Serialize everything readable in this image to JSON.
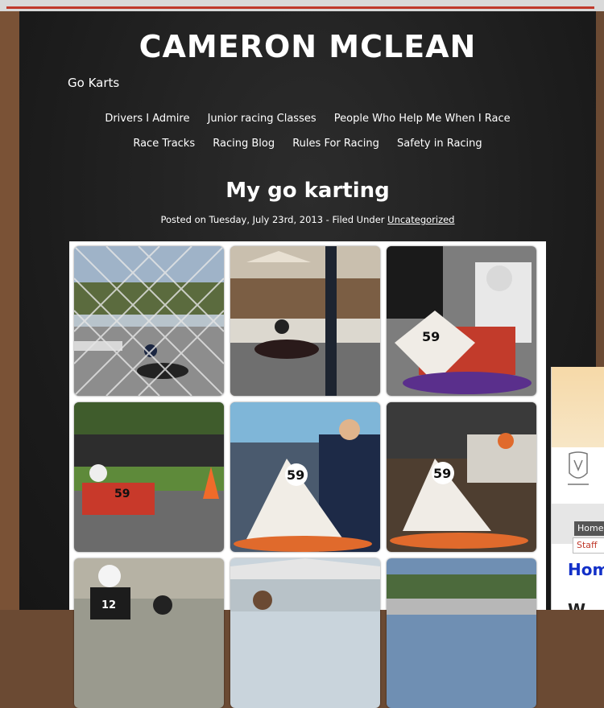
{
  "site": {
    "title": "CAMERON MCLEAN",
    "tagline": "Go Karts"
  },
  "nav": {
    "row1": [
      "Drivers I Admire",
      "Junior racing Classes",
      "People Who Help Me When I Race"
    ],
    "row2": [
      "Race Tracks",
      "Racing Blog",
      "Rules For Racing",
      "Safety in Racing"
    ]
  },
  "post": {
    "title": "My go karting",
    "meta_prefix": "Posted on Tuesday, July 23rd, 2013 - Filed Under",
    "category": "Uncategorized"
  },
  "gallery": {
    "photos": [
      "kart-behind-fence",
      "kart-on-track-tent",
      "driver-in-kart-59",
      "kart-orange-cone",
      "boy-with-kart-59",
      "two-karts-garage",
      "driver-helmet-12",
      "spectator-tent",
      "race-track-view"
    ],
    "sample_kart_number": "59",
    "sample_kart_number_2": "12"
  },
  "side_panel": {
    "tab_home": "Home",
    "tab_staff": "Staff",
    "link_home": "Hom",
    "heading_partial": "W"
  },
  "colors": {
    "board": "#1b1b1b",
    "frame": "#6b4a33",
    "accent_red": "#c0392b",
    "link_blue": "#1230c8"
  }
}
